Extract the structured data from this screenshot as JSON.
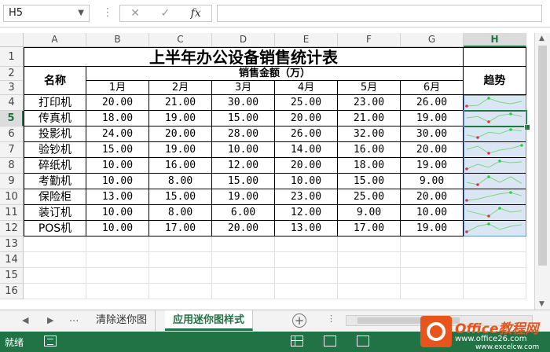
{
  "formula_bar": {
    "name_box": "H5",
    "fx_label": "fx",
    "cancel_symbol": "✕",
    "enter_symbol": "✓",
    "formula_value": ""
  },
  "column_headers": [
    "A",
    "B",
    "C",
    "D",
    "E",
    "F",
    "G",
    "H"
  ],
  "row_headers": [
    "1",
    "2",
    "3",
    "4",
    "5",
    "6",
    "7",
    "8",
    "9",
    "10",
    "11",
    "12",
    "13",
    "14",
    "15",
    "16"
  ],
  "table": {
    "title": "上半年办公设备销售统计表",
    "name_header": "名称",
    "sales_header": "销售金额（万）",
    "trend_header": "趋势",
    "months": [
      "1月",
      "2月",
      "3月",
      "4月",
      "5月",
      "6月"
    ],
    "rows": [
      {
        "name": "打印机",
        "values": [
          "20.00",
          "21.00",
          "30.00",
          "25.00",
          "23.00",
          "26.00"
        ],
        "spark": [
          20,
          21,
          30,
          25,
          23,
          26
        ]
      },
      {
        "name": "传真机",
        "values": [
          "18.00",
          "19.00",
          "15.00",
          "20.00",
          "21.00",
          "19.00"
        ],
        "spark": [
          18,
          19,
          15,
          20,
          21,
          19
        ]
      },
      {
        "name": "投影机",
        "values": [
          "24.00",
          "20.00",
          "28.00",
          "26.00",
          "32.00",
          "30.00"
        ],
        "spark": [
          24,
          20,
          28,
          26,
          32,
          30
        ]
      },
      {
        "name": "验钞机",
        "values": [
          "15.00",
          "19.00",
          "10.00",
          "14.00",
          "16.00",
          "20.00"
        ],
        "spark": [
          15,
          19,
          10,
          14,
          16,
          20
        ]
      },
      {
        "name": "碎纸机",
        "values": [
          "10.00",
          "16.00",
          "12.00",
          "20.00",
          "18.00",
          "19.00"
        ],
        "spark": [
          10,
          16,
          12,
          20,
          18,
          19
        ]
      },
      {
        "name": "考勤机",
        "values": [
          "10.00",
          "8.00",
          "15.00",
          "10.00",
          "15.00",
          "9.00"
        ],
        "spark": [
          10,
          8,
          15,
          10,
          15,
          9
        ]
      },
      {
        "name": "保险柜",
        "values": [
          "13.00",
          "15.00",
          "19.00",
          "23.00",
          "25.00",
          "20.00"
        ],
        "spark": [
          13,
          15,
          19,
          23,
          25,
          20
        ]
      },
      {
        "name": "装订机",
        "values": [
          "10.00",
          "8.00",
          "6.00",
          "12.00",
          "9.00",
          "10.00"
        ],
        "spark": [
          10,
          8,
          6,
          12,
          9,
          10
        ]
      },
      {
        "name": "POS机",
        "values": [
          "10.00",
          "17.00",
          "20.00",
          "13.00",
          "17.00",
          "19.00"
        ],
        "spark": [
          10,
          17,
          20,
          13,
          17,
          19
        ]
      }
    ]
  },
  "colors": {
    "excel_green": "#217346",
    "spark_line": "#7fd37f",
    "spark_high": "#2ecc40",
    "spark_low": "#e0304e",
    "spark_bg": "#dbe6f5"
  },
  "sheet_tabs": {
    "nav_more": "...",
    "tabs": [
      {
        "label": "清除迷你图",
        "active": false
      },
      {
        "label": "应用迷你图样式",
        "active": true
      }
    ],
    "add_symbol": "+"
  },
  "status_bar": {
    "status": "就绪"
  },
  "watermark": {
    "brand": "Office教程网",
    "site1": "www.office26.com",
    "site2": "www.excelcw.com"
  }
}
